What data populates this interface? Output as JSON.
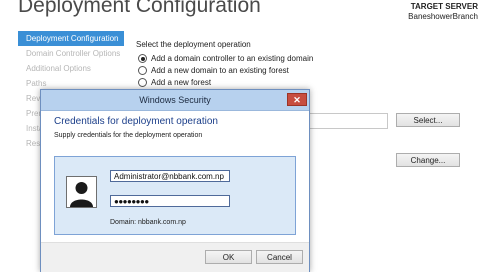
{
  "wizard": {
    "title": "Deployment Configuration",
    "target_server_label": "TARGET SERVER",
    "target_server_name": "BaneshowerBranch",
    "nav_items": [
      {
        "label": "Deployment Configuration",
        "active": true
      },
      {
        "label": "Domain Controller Options",
        "active": false
      },
      {
        "label": "Additional Options",
        "active": false
      },
      {
        "label": "Paths",
        "active": false
      },
      {
        "label": "Review Options",
        "active": false
      },
      {
        "label": "Prerequisites Check",
        "active": false
      },
      {
        "label": "Installation",
        "active": false
      },
      {
        "label": "Results",
        "active": false
      }
    ],
    "operation_label": "Select the deployment operation",
    "operations": [
      {
        "label": "Add a domain controller to an existing domain",
        "selected": true
      },
      {
        "label": "Add a new domain to an existing forest",
        "selected": false
      },
      {
        "label": "Add a new forest",
        "selected": false
      }
    ],
    "select_button": "Select...",
    "change_button": "Change..."
  },
  "dialog": {
    "window_title": "Windows Security",
    "close_symbol": "✕",
    "heading": "Credentials for deployment operation",
    "subheading": "Supply credentials for the deployment operation",
    "username_value": "Administrator@nbbank.com.np",
    "password_mask": "●●●●●●●●",
    "domain_text": "Domain: nbbank.com.np",
    "ok_button": "OK",
    "cancel_button": "Cancel"
  },
  "colors": {
    "nav_active": "#3a8fd6",
    "dialog_titlebar": "#b7d1ee",
    "credential_tile": "#dbe9f7",
    "heading": "#1c3f8a"
  },
  "icons": {
    "avatar": "user-silhouette-icon",
    "close": "close-icon"
  }
}
